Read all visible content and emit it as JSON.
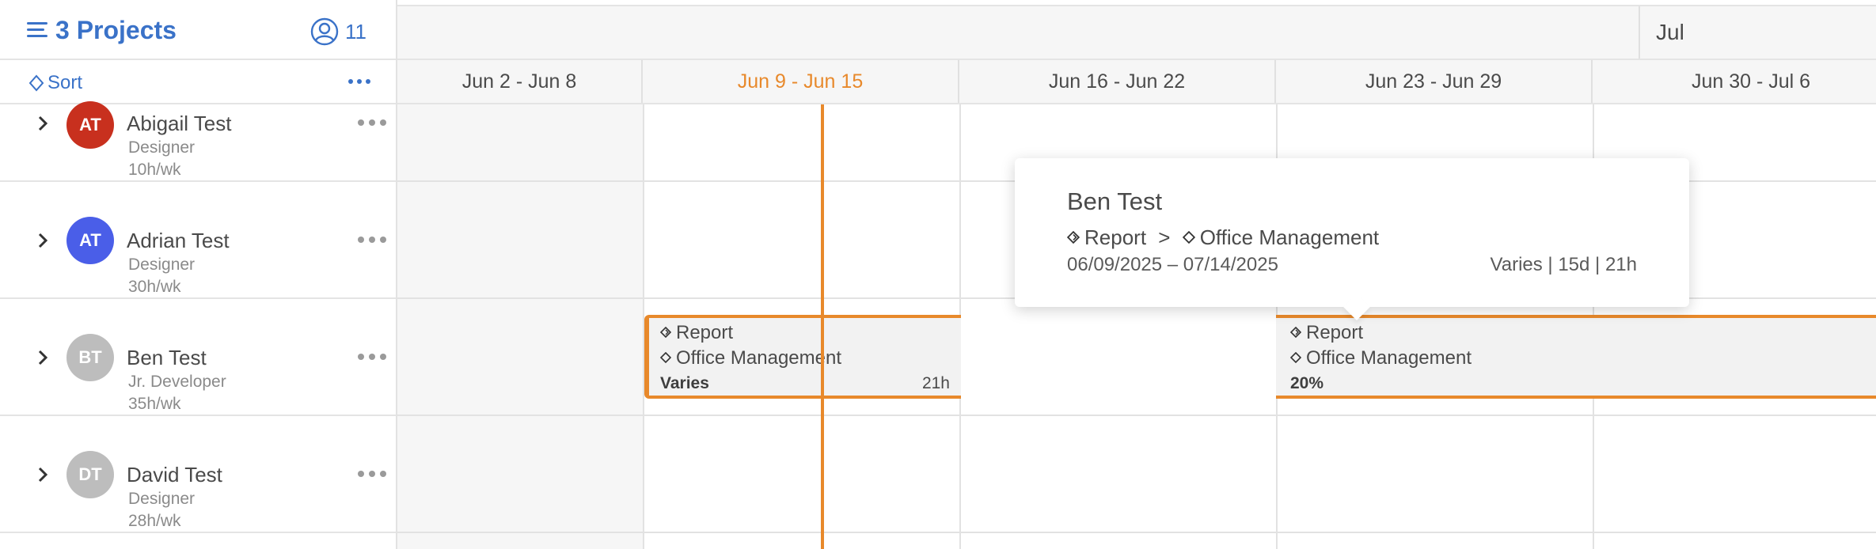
{
  "header": {
    "projects_title": "3 Projects",
    "people_count": "11",
    "sort_label": "Sort"
  },
  "months": [
    {
      "label": "Jul"
    }
  ],
  "weeks": [
    {
      "label": "Jun 2 - Jun 8",
      "current": false
    },
    {
      "label": "Jun 9 - Jun 15",
      "current": true
    },
    {
      "label": "Jun 16 - Jun 22",
      "current": false
    },
    {
      "label": "Jun 23 - Jun 29",
      "current": false
    },
    {
      "label": "Jun 30 - Jul 6",
      "current": false
    }
  ],
  "people": [
    {
      "initials": "AT",
      "name": "Abigail Test",
      "role": "Designer",
      "hours": "10h/wk",
      "avatar_color": "#c8301e"
    },
    {
      "initials": "AT",
      "name": "Adrian Test",
      "role": "Designer",
      "hours": "30h/wk",
      "avatar_color": "#4a5ee8"
    },
    {
      "initials": "BT",
      "name": "Ben Test",
      "role": "Jr. Developer",
      "hours": "35h/wk",
      "avatar_color": "#bdbdbd"
    },
    {
      "initials": "DT",
      "name": "David Test",
      "role": "Designer",
      "hours": "28h/wk",
      "avatar_color": "#bdbdbd"
    }
  ],
  "bars": [
    {
      "phase": "Report",
      "project": "Office Management",
      "footer_left": "Varies",
      "footer_right": "21h"
    },
    {
      "phase": "Report",
      "project": "Office Management",
      "footer_left": "20%",
      "footer_right": ""
    }
  ],
  "tooltip": {
    "name": "Ben Test",
    "phase": "Report",
    "separator": ">",
    "project": "Office Management",
    "date_range": "06/09/2025 – 07/14/2025",
    "stats": "Varies | 15d | 21h"
  },
  "colors": {
    "accent_blue": "#3a72c8",
    "accent_orange": "#e8892b"
  }
}
